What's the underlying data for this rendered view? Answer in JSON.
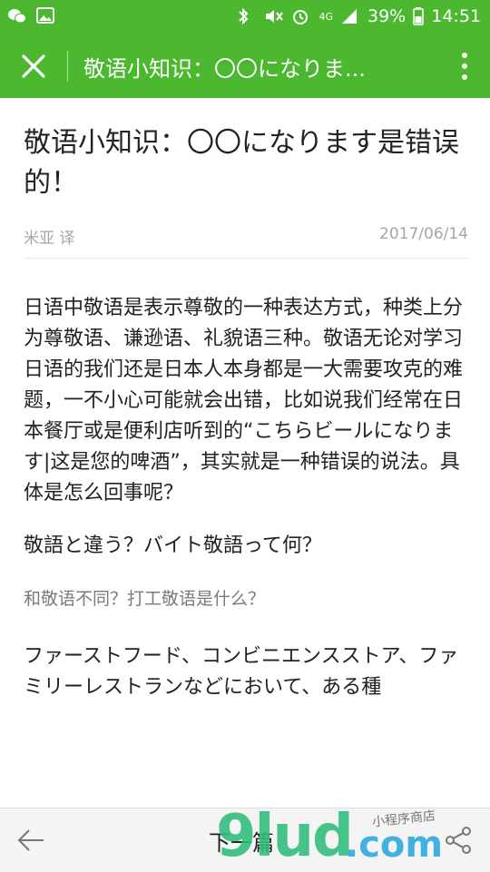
{
  "status": {
    "network": "4G",
    "battery": "39%",
    "time": "14:51"
  },
  "appbar": {
    "title": "敬语小知识：〇〇になりま..."
  },
  "article": {
    "title": "敬语小知识：〇〇になります是错误的！",
    "author": "米亚 译",
    "date": "2017/06/14",
    "paragraphs": [
      "日语中敬语是表示尊敬的一种表达方式，种类上分为尊敬语、谦逊语、礼貌语三种。敬语无论对学习日语的我们还是日本人本身都是一大需要攻克的难题，一不小心可能就会出错，比如说我们经常在日本餐厅或是便利店听到的“こちらビールになります|这是您的啤酒”，其实就是一种错误的说法。具体是怎么回事呢？",
      "敬語と違う？バイト敬語って何？",
      "和敬语不同？打工敬语是什么？",
      "ファーストフード、コンビニエンスストア、ファミリーレストランなどにおいて、ある種"
    ]
  },
  "bottom": {
    "next_label": "下一篇"
  },
  "watermark": {
    "brand": "9lud",
    "suffix": ".com",
    "tagline": "小程序商店"
  },
  "colors": {
    "accent": "#4cb82f"
  },
  "icons": [
    "wechat-icon",
    "image-icon",
    "bluetooth-icon",
    "mute-icon",
    "alarm-icon",
    "signal-icon",
    "battery-icon",
    "close-icon",
    "more-icon",
    "back-arrow-icon",
    "share-icon"
  ]
}
